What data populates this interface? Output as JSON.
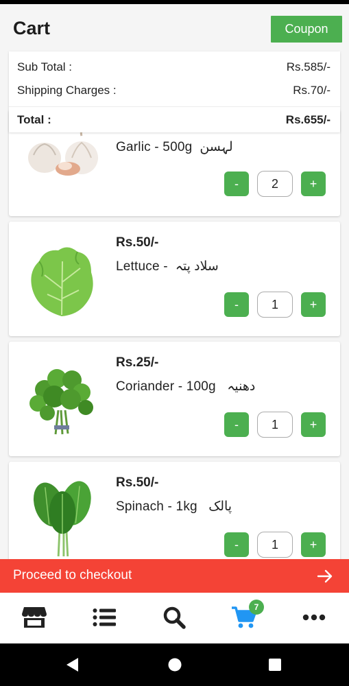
{
  "header": {
    "title": "Cart",
    "coupon_label": "Coupon"
  },
  "summary": {
    "subtotal_label": "Sub Total :",
    "subtotal_value": "Rs.585/-",
    "shipping_label": "Shipping Charges :",
    "shipping_value": "Rs.70/-",
    "total_label": "Total :",
    "total_value": "Rs.655/-"
  },
  "items": [
    {
      "name": "Garlic - 500g",
      "urdu": "لہسن",
      "price": "",
      "qty": "2",
      "minus": "-",
      "plus": "+",
      "image": "garlic-image"
    },
    {
      "name": "Lettuce -",
      "urdu": "سلاد پتہ",
      "price": "Rs.50/-",
      "qty": "1",
      "minus": "-",
      "plus": "+",
      "image": "lettuce-image"
    },
    {
      "name": "Coriander - 100g",
      "urdu": "دھنیہ",
      "price": "Rs.25/-",
      "qty": "1",
      "minus": "-",
      "plus": "+",
      "image": "coriander-image"
    },
    {
      "name": "Spinach - 1kg",
      "urdu": "پالک",
      "price": "Rs.50/-",
      "qty": "1",
      "minus": "-",
      "plus": "+",
      "image": "spinach-image"
    }
  ],
  "checkout": {
    "label": "Proceed to checkout",
    "icon": "arrow-right-icon"
  },
  "bottom_nav": {
    "items": [
      "store-icon",
      "list-icon",
      "search-icon",
      "cart-icon",
      "more-icon"
    ],
    "cart_badge": "7",
    "active_color": "#2196f3"
  },
  "colors": {
    "accent": "#4caf50",
    "checkout": "#f44336"
  }
}
